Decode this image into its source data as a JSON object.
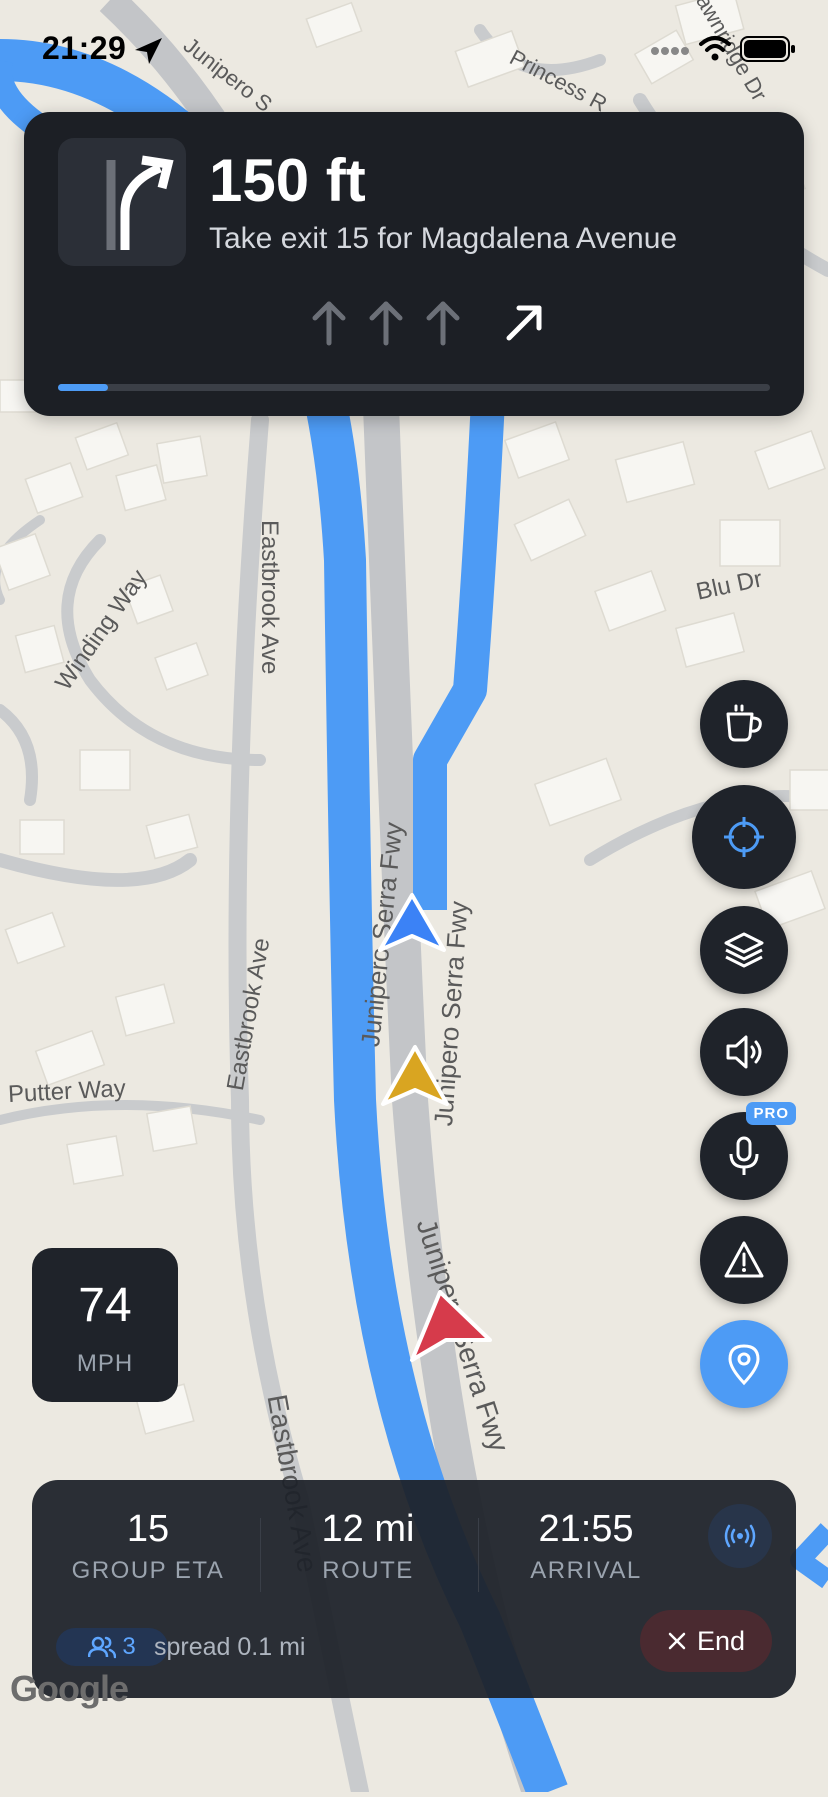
{
  "status_bar": {
    "time": "21:29"
  },
  "map": {
    "labels": {
      "junipero_top": "Junipero S",
      "princess": "Princess R",
      "dawnridge": "Dawnridge Dr",
      "blu_dr": "Blu Dr",
      "eastbrook_1": "Eastbrook Ave",
      "eastbrook_2": "Eastbrook Ave",
      "eastbrook_3": "Eastbrook Ave",
      "winding_way": "Winding Way",
      "putter_way": "Putter Way",
      "junipero_1": "Junipero Serra Fwy",
      "junipero_2": "Junipero Serra Fwy",
      "junipero_3": "Junipero Serra Fwy"
    },
    "colors": {
      "route": "#4d9bf5",
      "marker_self": "#3b82f6",
      "marker_yellow": "#d9a521",
      "marker_red": "#d63b4b"
    }
  },
  "navigation": {
    "distance": "150 ft",
    "instruction": "Take exit 15 for Magdalena Avenue",
    "maneuver_icon": "exit-right-arrow-icon",
    "lanes": [
      "straight",
      "straight",
      "straight",
      "right-active"
    ],
    "progress_fraction": 0.07
  },
  "fab_buttons": [
    {
      "name": "coffee-icon"
    },
    {
      "name": "recenter-icon"
    },
    {
      "name": "layers-icon"
    },
    {
      "name": "speaker-icon"
    },
    {
      "name": "microphone-icon",
      "badge": "PRO"
    },
    {
      "name": "warning-icon"
    },
    {
      "name": "location-pin-icon"
    }
  ],
  "speed": {
    "value": "74",
    "unit": "MPH"
  },
  "trip": {
    "group_eta_value": "15",
    "group_eta_label": "GROUP ETA",
    "route_value": "12 mi",
    "route_label": "ROUTE",
    "arrival_value": "21:55",
    "arrival_label": "ARRIVAL",
    "group_count": "3",
    "spread": "spread 0.1 mi",
    "end_label": "End"
  },
  "google": "Google"
}
